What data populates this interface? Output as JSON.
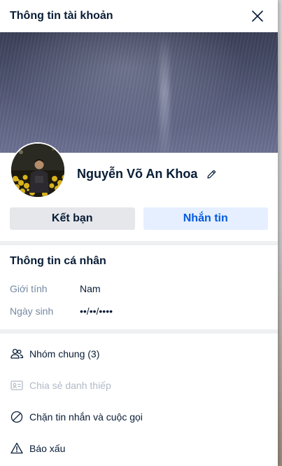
{
  "header": {
    "title": "Thông tin tài khoản"
  },
  "profile": {
    "name": "Nguyễn Võ An Khoa"
  },
  "actions": {
    "friend_label": "Kết bạn",
    "message_label": "Nhắn tin"
  },
  "personal_info": {
    "title": "Thông tin cá nhân",
    "rows": [
      {
        "label": "Giới tính",
        "value": "Nam"
      },
      {
        "label": "Ngày sinh",
        "value": "••/••/••••"
      }
    ]
  },
  "menu": [
    {
      "label": "Nhóm chung (3)",
      "icon": "group-icon",
      "enabled": true
    },
    {
      "label": "Chia sẻ danh thiếp",
      "icon": "contact-card-icon",
      "enabled": false
    },
    {
      "label": "Chặn tin nhắn và cuộc gọi",
      "icon": "block-icon",
      "enabled": true
    },
    {
      "label": "Báo xấu",
      "icon": "warning-icon",
      "enabled": true
    }
  ],
  "colors": {
    "text_primary": "#081c36",
    "text_secondary": "#7589a3",
    "accent": "#005ae0",
    "accent_bg": "#e5efff",
    "neutral_button": "#e5e7eb"
  }
}
